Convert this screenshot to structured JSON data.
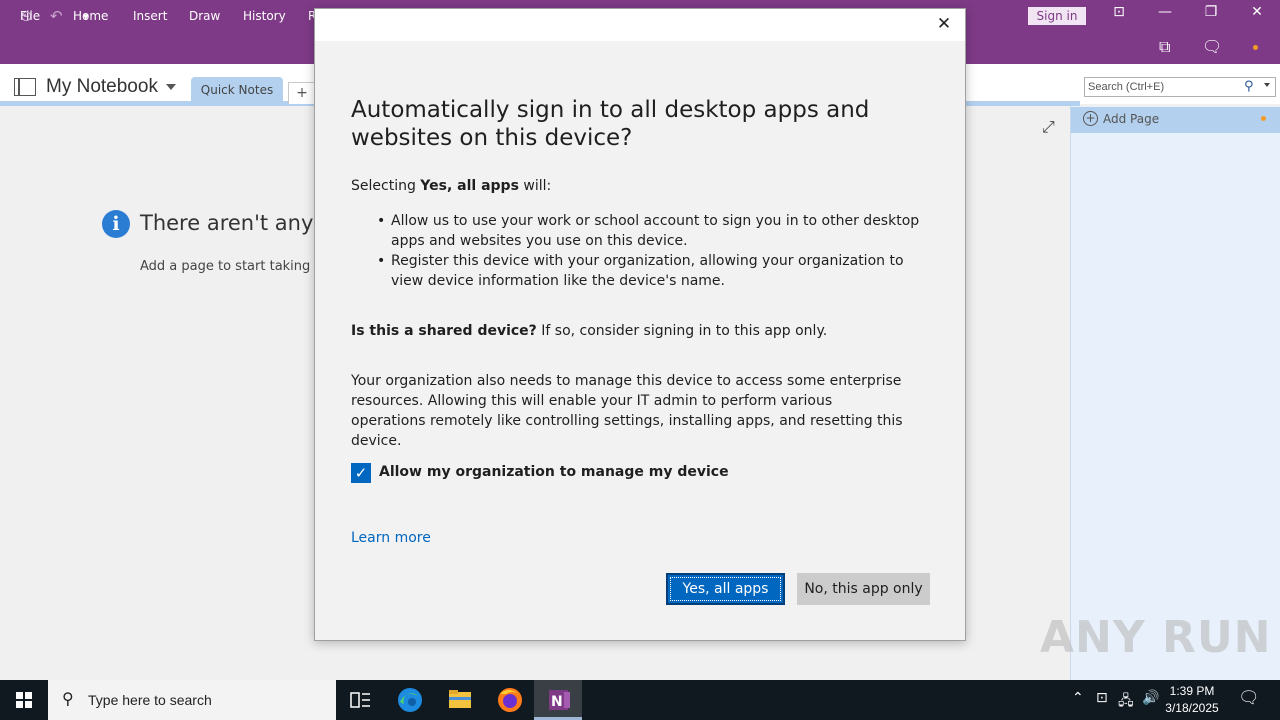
{
  "titlebar": {
    "sign_in_label": "Sign in"
  },
  "ribbon": {
    "tabs": [
      "File",
      "Home",
      "Insert",
      "Draw",
      "History",
      "R"
    ]
  },
  "notebook": {
    "title": "My Notebook",
    "section_tab": "Quick Notes",
    "add_section": "+",
    "search_placeholder": "Search (Ctrl+E)"
  },
  "page_area": {
    "empty_title": "There aren't any pa",
    "empty_subtitle": "Add a page to start taking n"
  },
  "pages_pane": {
    "add_page_label": "Add Page"
  },
  "dialog": {
    "title": "Automatically sign in to all desktop apps and websites on this device?",
    "selecting_prefix": "Selecting ",
    "selecting_bold": "Yes, all apps",
    "selecting_suffix": " will:",
    "bullets": [
      "Allow us to use your work or school account to sign you in to other desktop apps and websites you use on this device.",
      "Register this device with your organization, allowing your organization to view device information like the device's name."
    ],
    "shared_bold": "Is this a shared device?",
    "shared_rest": " If so, consider signing in to this app only.",
    "org_paragraph": "Your organization also needs to manage this device to access some enterprise resources. Allowing this will enable your IT admin to perform various operations remotely like controlling settings, installing apps, and resetting this device.",
    "checkbox_label": "Allow my organization to manage my device",
    "checkbox_checked": true,
    "learn_more": "Learn more",
    "yes_button": "Yes, all apps",
    "no_button": "No, this app only"
  },
  "watermark": {
    "text": "ANY RUN"
  },
  "taskbar": {
    "search_placeholder": "Type here to search",
    "time": "1:39 PM",
    "date": "3/18/2025"
  },
  "colors": {
    "onenote_purple": "#7e3a86",
    "accent_blue": "#0067c0",
    "section_blue": "#b3d0ee",
    "taskbar": "#101820"
  }
}
